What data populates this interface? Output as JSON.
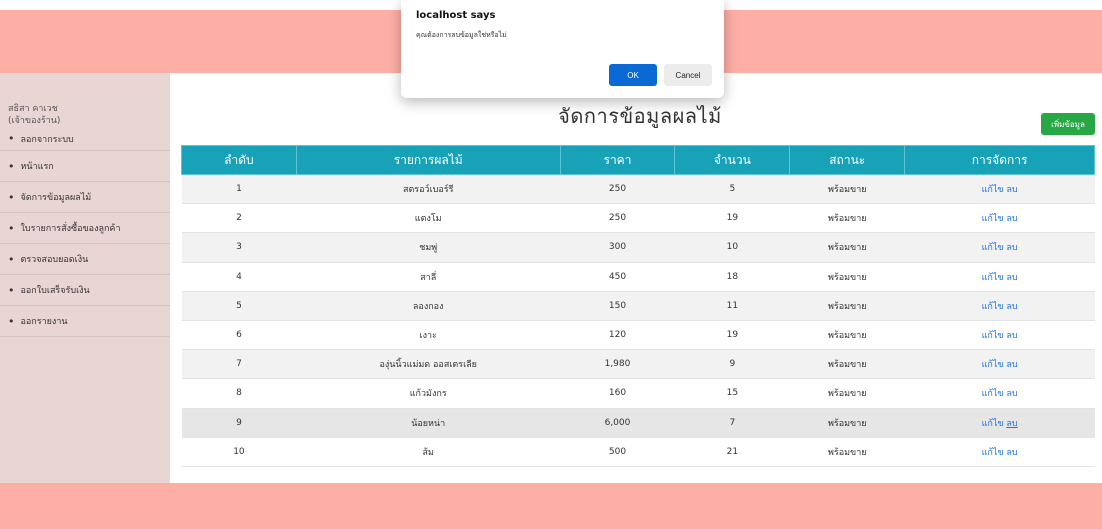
{
  "sidebar": {
    "user_name": "สธิสา คาเวช",
    "user_role": "(เจ้าของร้าน)",
    "items": [
      {
        "label": "ลอกจากระบบ"
      },
      {
        "label": "หน้าแรก"
      },
      {
        "label": "จัดการข้อมูลผลไม้"
      },
      {
        "label": "ใบรายการสั่งซื้อของลูกค้า"
      },
      {
        "label": "ตรวจสอบยอดเงิน"
      },
      {
        "label": "ออกใบเสร็จรับเงิน"
      },
      {
        "label": "ออกรายงาน"
      }
    ],
    "bullet": "•"
  },
  "main": {
    "title": "จัดการข้อมูลผลไม้",
    "add_button": "เพิ่มข้อมูล"
  },
  "table": {
    "headers": {
      "no": "ลำดับ",
      "name": "รายการผลไม้",
      "price": "ราคา",
      "qty": "จำนวน",
      "status": "สถานะ",
      "actions": "การจัดการ"
    },
    "rows": [
      {
        "no": "1",
        "name": "สตรอว์เบอร์รี",
        "price": "250",
        "qty": "5",
        "status": "พร้อมขาย",
        "edit": "แก้ไข",
        "del": "ลบ"
      },
      {
        "no": "2",
        "name": "แตงโม",
        "price": "250",
        "qty": "19",
        "status": "พร้อมขาย",
        "edit": "แก้ไข",
        "del": "ลบ"
      },
      {
        "no": "3",
        "name": "ชมพู่",
        "price": "300",
        "qty": "10",
        "status": "พร้อมขาย",
        "edit": "แก้ไข",
        "del": "ลบ"
      },
      {
        "no": "4",
        "name": "สาลี่",
        "price": "450",
        "qty": "18",
        "status": "พร้อมขาย",
        "edit": "แก้ไข",
        "del": "ลบ"
      },
      {
        "no": "5",
        "name": "ลองกอง",
        "price": "150",
        "qty": "11",
        "status": "พร้อมขาย",
        "edit": "แก้ไข",
        "del": "ลบ"
      },
      {
        "no": "6",
        "name": "เงาะ",
        "price": "120",
        "qty": "19",
        "status": "พร้อมขาย",
        "edit": "แก้ไข",
        "del": "ลบ"
      },
      {
        "no": "7",
        "name": "องุ่นนิ้วแม่มด ออสเตรเลีย",
        "price": "1,980",
        "qty": "9",
        "status": "พร้อมขาย",
        "edit": "แก้ไข",
        "del": "ลบ"
      },
      {
        "no": "8",
        "name": "แก้วมังกร",
        "price": "160",
        "qty": "15",
        "status": "พร้อมขาย",
        "edit": "แก้ไข",
        "del": "ลบ"
      },
      {
        "no": "9",
        "name": "น้อยหน่า",
        "price": "6,000",
        "qty": "7",
        "status": "พร้อมขาย",
        "edit": "แก้ไข",
        "del": "ลบ"
      },
      {
        "no": "10",
        "name": "ส้ม",
        "price": "500",
        "qty": "21",
        "status": "พร้อมขาย",
        "edit": "แก้ไข",
        "del": "ลบ"
      }
    ]
  },
  "dialog": {
    "title": "localhost says",
    "message": "คุณต้องการลบข้อมูลใช่หรือไม่",
    "ok": "OK",
    "cancel": "Cancel"
  },
  "colors": {
    "header_bg": "#fdafa6",
    "sidebar_bg": "#ead5d5",
    "table_header_bg": "#17a2b8",
    "add_button_bg": "#28a745",
    "ok_button_bg": "#0b69d6",
    "link": "#1a73e8"
  }
}
